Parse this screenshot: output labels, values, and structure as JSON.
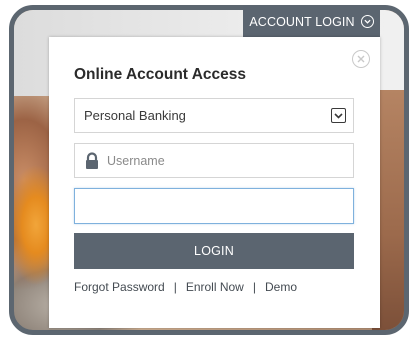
{
  "header": {
    "login_tab_label": "ACCOUNT LOGIN"
  },
  "panel": {
    "title": "Online Account Access",
    "account_type": {
      "selected": "Personal Banking"
    },
    "username": {
      "placeholder": "Username",
      "value": ""
    },
    "password": {
      "value": ""
    },
    "login_button": "LOGIN",
    "links": {
      "forgot_password": "Forgot Password",
      "enroll_now": "Enroll Now",
      "demo": "Demo",
      "separator": "|"
    }
  },
  "icons": {
    "tab_chevron": "chevron-down-circle-icon",
    "close": "close-circle-icon",
    "select_arrow": "chevron-down-icon",
    "lock": "lock-icon"
  },
  "colors": {
    "frame": "#5c6670",
    "tab_background": "#5b6570",
    "button_background": "#5b6570",
    "focused_border": "#7fb1dd"
  }
}
